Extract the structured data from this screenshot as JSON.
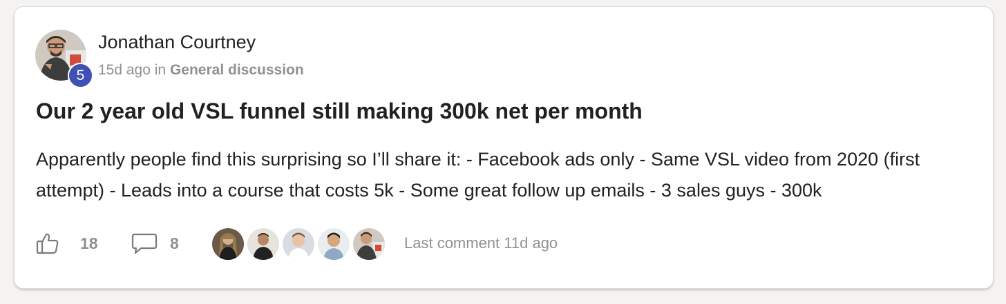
{
  "post": {
    "author": "Jonathan Courtney",
    "level": "5",
    "time_ago": "15d ago",
    "in_word": "in",
    "category": "General discussion",
    "title": "Our 2 year old VSL funnel still making 300k net per month",
    "body": "Apparently people find this surprising so I’ll share it: - Facebook ads only - Same VSL video from 2020 (first attempt) - Leads into a course that costs 5k - Some great follow up emails - 3 sales guys - 300k"
  },
  "footer": {
    "likes": "18",
    "comments": "8",
    "last_comment": "Last comment 11d ago",
    "like_icon": "thumbs-up-icon",
    "comment_icon": "chat-bubble-icon"
  },
  "colors": {
    "badge": "#3f51b5",
    "muted": "#909090",
    "text": "#202124"
  }
}
